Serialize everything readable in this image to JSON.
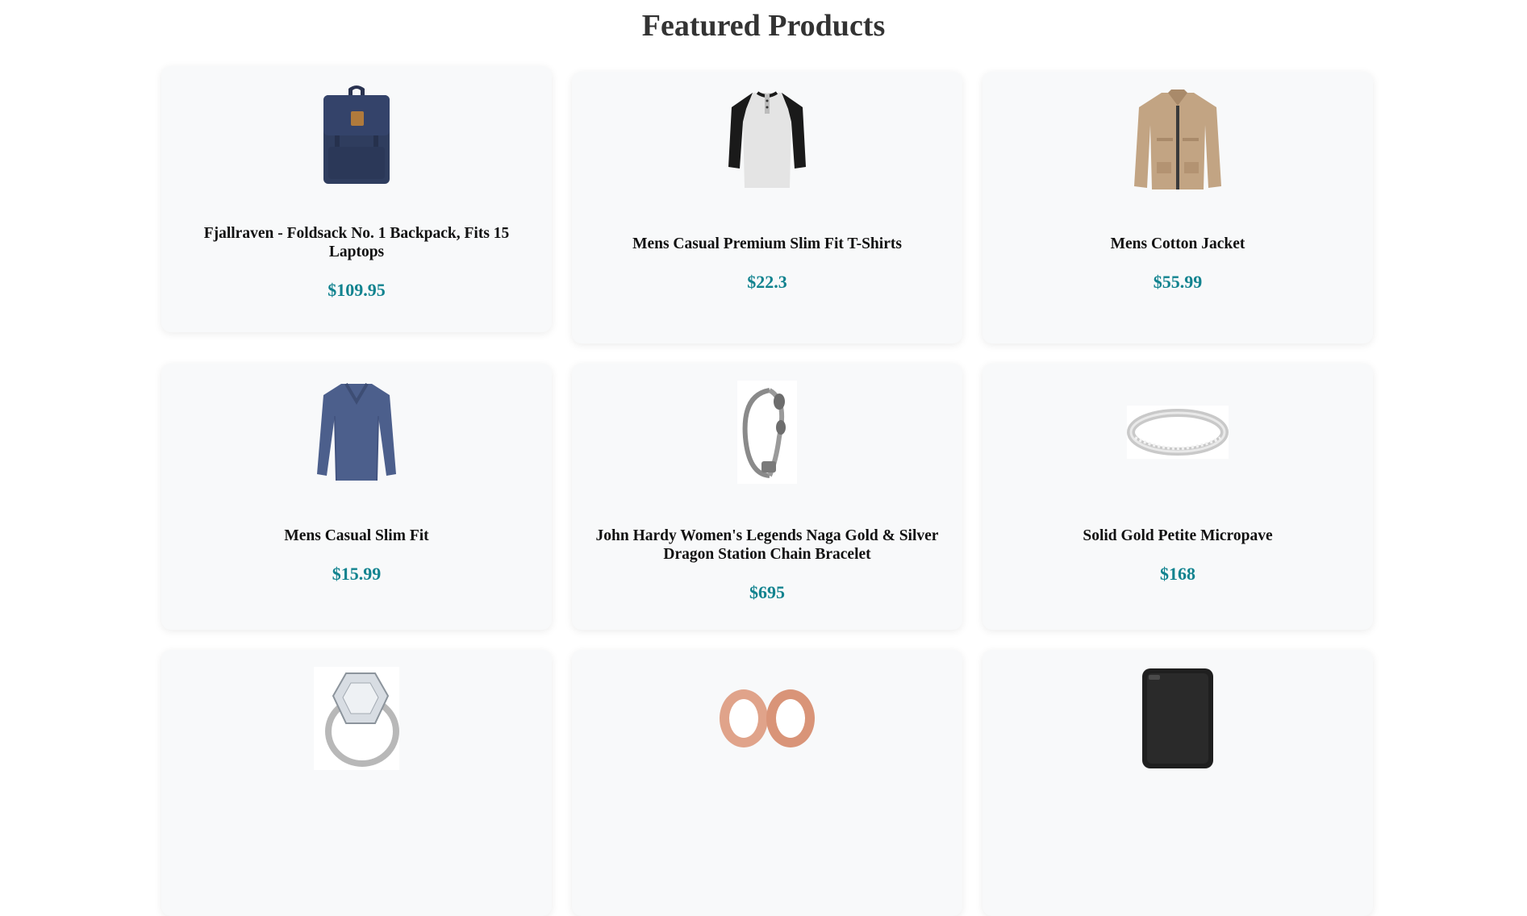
{
  "header": {
    "title": "Featured Products"
  },
  "products": [
    {
      "name": "Fjallraven - Foldsack No. 1 Backpack, Fits 15 Laptops",
      "price": "$109.95",
      "icon": "backpack-icon"
    },
    {
      "name": "Mens Casual Premium Slim Fit T-Shirts",
      "price": "$22.3",
      "icon": "tshirt-icon"
    },
    {
      "name": "Mens Cotton Jacket",
      "price": "$55.99",
      "icon": "jacket-icon"
    },
    {
      "name": "Mens Casual Slim Fit",
      "price": "$15.99",
      "icon": "longsleeve-icon"
    },
    {
      "name": "John Hardy Women's Legends Naga Gold & Silver Dragon Station Chain Bracelet",
      "price": "$695",
      "icon": "bracelet-icon"
    },
    {
      "name": "Solid Gold Petite Micropave",
      "price": "$168",
      "icon": "ring-icon"
    },
    {
      "name": "",
      "price": "",
      "icon": "diamond-ring-icon"
    },
    {
      "name": "",
      "price": "",
      "icon": "rose-gold-plugs-icon"
    },
    {
      "name": "",
      "price": "",
      "icon": "hard-drive-icon"
    }
  ],
  "colors": {
    "price": "#12838f",
    "card_bg": "#f8f9fa",
    "title": "#333333"
  }
}
